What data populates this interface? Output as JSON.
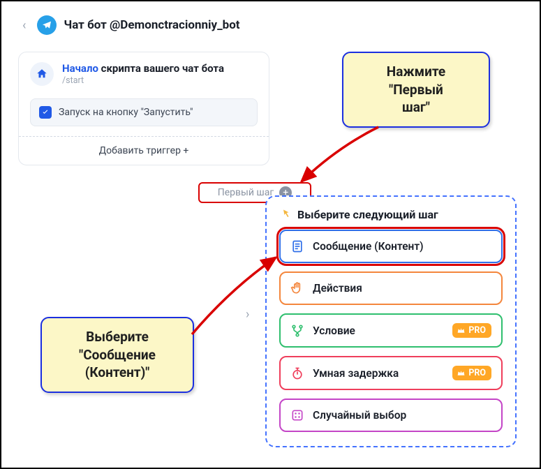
{
  "header": {
    "title": "Чат бот @Demonctracionniy_bot"
  },
  "start_card": {
    "title_blue": "Начало",
    "title_rest": " скрипта вашего чат бота",
    "subtitle": "/start",
    "trigger_label": "Запуск на кнопку \"Запустить\"",
    "add_trigger": "Добавить триггер  +"
  },
  "first_step_pill": "Первый шаг",
  "step_panel": {
    "heading": "Выберите следующий шаг",
    "options": {
      "message": "Сообщение (Контент)",
      "actions": "Действия",
      "condition": "Условие",
      "delay": "Умная задержка",
      "random": "Случайный выбор"
    },
    "pro_label": "PRO"
  },
  "callouts": {
    "c1_line1": "Нажмите",
    "c1_line2": "\"Первый",
    "c1_line3": "шаг\"",
    "c2_line1": "Выберите",
    "c2_line2": "\"Сообщение",
    "c2_line3": "(Контент)\""
  }
}
